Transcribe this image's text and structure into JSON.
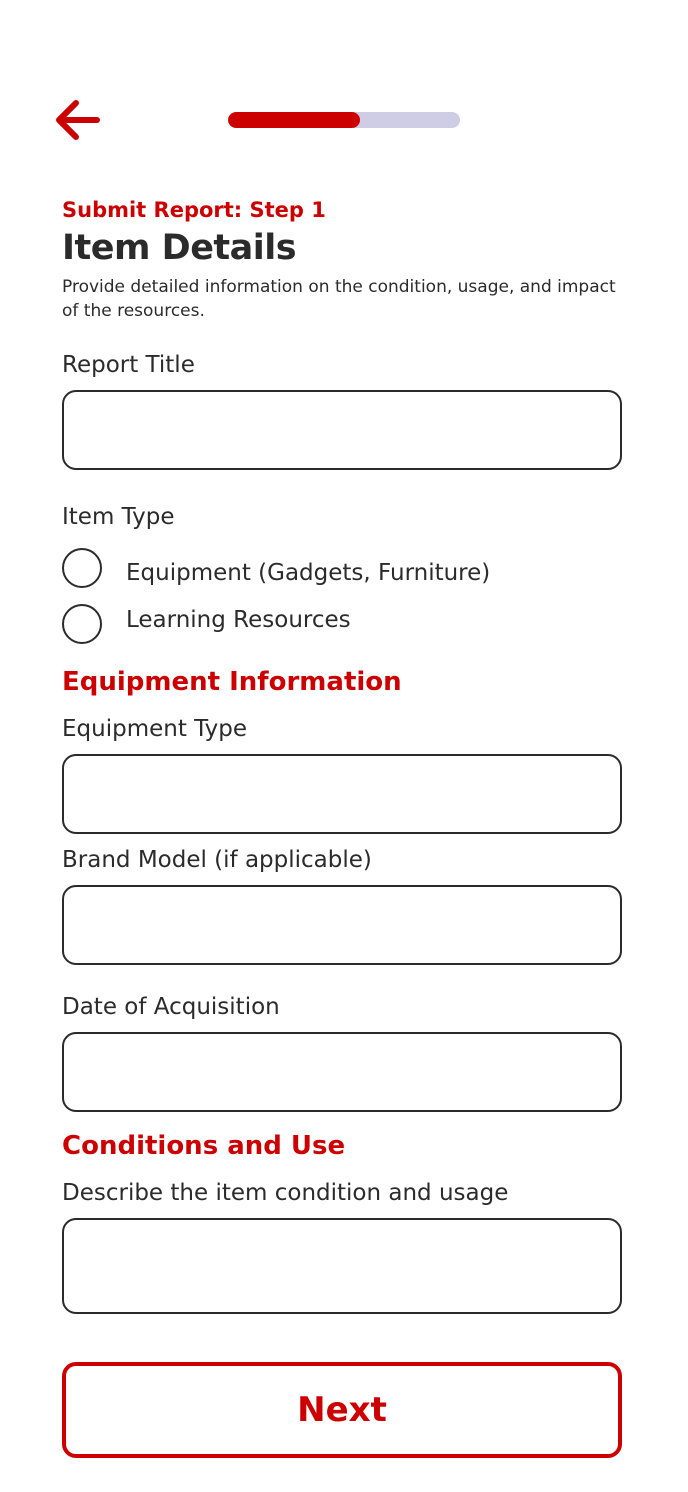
{
  "header": {
    "back_icon": "arrow-left-icon",
    "progress_fraction": 0.57,
    "colors": {
      "accent": "#cc0000",
      "progress_track": "#cfcde6",
      "text": "#2b2b2b"
    }
  },
  "intro": {
    "step_label": "Submit Report: Step 1",
    "title": "Item Details",
    "description": "Provide detailed information on the condition, usage, and impact of the resources."
  },
  "form": {
    "report_title": {
      "label": "Report Title",
      "value": "",
      "placeholder": ""
    },
    "item_type": {
      "label": "Item Type",
      "options": [
        {
          "label": "Equipment (Gadgets, Furniture)",
          "selected": false
        },
        {
          "label": "Learning Resources",
          "selected": false
        }
      ]
    },
    "equipment_section": {
      "title": "Equipment Information",
      "equipment_type": {
        "label": "Equipment Type",
        "value": "",
        "placeholder": ""
      },
      "brand_model": {
        "label": "Brand Model (if applicable)",
        "value": "",
        "placeholder": ""
      },
      "date_of_acquisition": {
        "label": "Date of Acquisition",
        "value": "",
        "placeholder": ""
      }
    },
    "conditions_section": {
      "title": "Conditions and Use",
      "description": {
        "label": "Describe the item condition and usage",
        "value": "",
        "placeholder": ""
      }
    }
  },
  "footer": {
    "next_label": "Next"
  }
}
